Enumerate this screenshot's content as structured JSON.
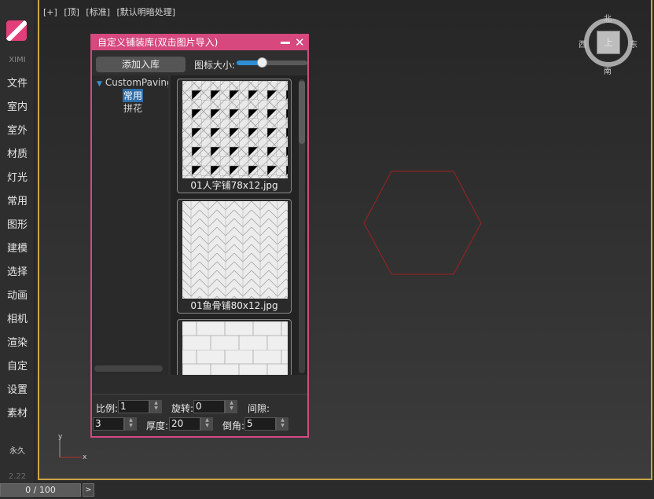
{
  "app": {
    "brand": "XIMI"
  },
  "sidebar": {
    "items": [
      {
        "label": "文件"
      },
      {
        "label": "室内"
      },
      {
        "label": "室外"
      },
      {
        "label": "材质"
      },
      {
        "label": "灯光"
      },
      {
        "label": "常用"
      },
      {
        "label": "图形"
      },
      {
        "label": "建模"
      },
      {
        "label": "选择"
      },
      {
        "label": "动画"
      },
      {
        "label": "相机"
      },
      {
        "label": "渲染"
      },
      {
        "label": "自定"
      },
      {
        "label": "设置"
      },
      {
        "label": "素材"
      }
    ],
    "footer_label": "永久",
    "version": "2.22"
  },
  "viewport": {
    "labels": [
      "[+]",
      "[顶]",
      "[标准]",
      "[默认明暗处理]"
    ],
    "compass": {
      "north": "北",
      "south": "南",
      "east": "东",
      "west": "西",
      "face": "上"
    },
    "axis": {
      "y": "y",
      "x": "x"
    },
    "hexagon_color": "#a02020",
    "frame_color": "#c9a645"
  },
  "timeline": {
    "value": "0 / 100",
    "next_glyph": ">"
  },
  "dialog": {
    "title": "自定义铺装库(双击图片导入)",
    "add_button": "添加入库",
    "icon_size_label": "图标大小:",
    "icon_size_value": 0.36,
    "accent_color": "#d6487e",
    "tree": {
      "root": "CustomPaving",
      "children": [
        {
          "label": "常用",
          "selected": true
        },
        {
          "label": "拼花",
          "selected": false
        }
      ]
    },
    "tiles": [
      {
        "label": "01人字铺78x12.jpg",
        "pattern": "herringbone"
      },
      {
        "label": "01鱼骨铺80x12.jpg",
        "pattern": "chevron"
      },
      {
        "label": "",
        "pattern": "brick"
      }
    ],
    "fields": {
      "scale_label": "比例:",
      "scale_value": "1",
      "rotation_label": "旋转:",
      "rotation_value": "0",
      "gap_label": "间隙:",
      "gap_value": "3",
      "thickness_label": "厚度:",
      "thickness_value": "20",
      "bevel_label": "倒角:",
      "bevel_value": "5"
    }
  }
}
